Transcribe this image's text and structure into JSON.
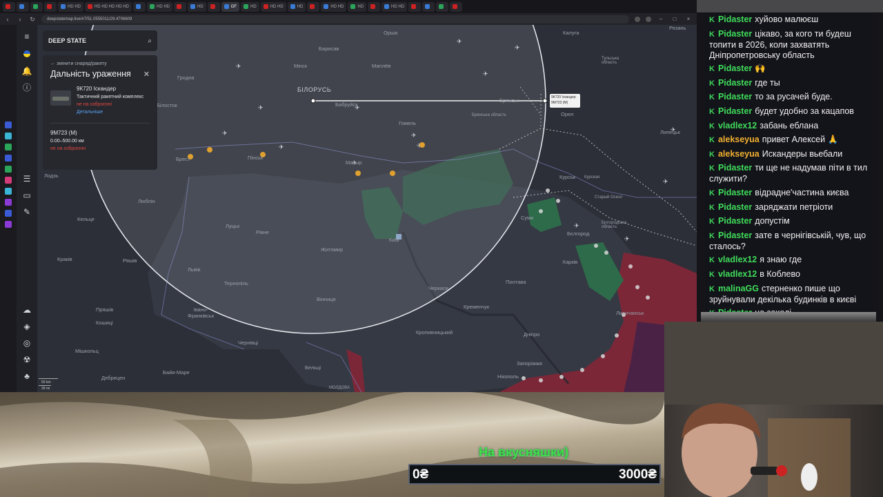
{
  "browser": {
    "tabs": [
      "",
      "",
      "",
      "",
      "HD HD",
      "HD HD HD HD HD",
      "",
      "HD HD",
      "",
      "HD",
      "",
      "GF",
      "HD",
      "HD HD",
      "HD",
      "",
      "HD HD",
      "HD",
      "",
      "HD HD",
      "",
      "",
      "",
      ""
    ],
    "url": "deepstatemap.live/#7/51.0555011/29.4706609"
  },
  "deepstate": {
    "logo": "DEEP STATE",
    "back_link": "змінити снаряд/ракету",
    "title": "Дальність ураження",
    "weapon_name": "9К720 Іскандер",
    "weapon_type": "Тактичний ракетний комплекс",
    "weapon_status": "не на озброєнні",
    "details_link": "Детальніше",
    "missile_name": "9М723 (М)",
    "missile_range": "0.00–500.00 км",
    "missile_status": "не на озброєнні"
  },
  "map": {
    "tooltip_line1": "9К720 Іскандер",
    "tooltip_line2": "9М723 (М)",
    "scale_km": "50 km",
    "scale_mi": "30 mi",
    "cities": [
      {
        "name": "Орша"
      },
      {
        "name": "Калуга"
      },
      {
        "name": "Барисав"
      },
      {
        "name": "Мінск"
      },
      {
        "name": "Магілёв"
      },
      {
        "name": "Гродна"
      },
      {
        "name": "БІЛОРУСЬ"
      },
      {
        "name": "Бабруйск"
      },
      {
        "name": "Брянськ"
      },
      {
        "name": "Орел"
      },
      {
        "name": "Гомель"
      },
      {
        "name": "Пінськ"
      },
      {
        "name": "Мазыр"
      },
      {
        "name": "Брест"
      },
      {
        "name": "Лодзь"
      },
      {
        "name": "Люблін"
      },
      {
        "name": "Луцьк"
      },
      {
        "name": "Рівне"
      },
      {
        "name": "Житомир"
      },
      {
        "name": "Київ"
      },
      {
        "name": "Суми"
      },
      {
        "name": "Курськ"
      },
      {
        "name": "Харків"
      },
      {
        "name": "Полтава"
      },
      {
        "name": "Кременчук"
      },
      {
        "name": "Черкаси"
      },
      {
        "name": "Львів"
      },
      {
        "name": "Тернопіль"
      },
      {
        "name": "Вінниця"
      },
      {
        "name": "Кракiв"
      },
      {
        "name": "Ряшів"
      },
      {
        "name": "Кельце"
      },
      {
        "name": "Пряшів"
      },
      {
        "name": "Кошиці"
      },
      {
        "name": "Мішкольц"
      },
      {
        "name": "Дебрецен"
      },
      {
        "name": "Байя-Маре"
      },
      {
        "name": "Чернівці"
      },
      {
        "name": "Бельці"
      },
      {
        "name": "Кропивницький"
      },
      {
        "name": "Дніпро"
      },
      {
        "name": "Запоріжжя"
      },
      {
        "name": "Нікополь"
      },
      {
        "name": "Лисичанськ"
      },
      {
        "name": "Бєлгород"
      },
      {
        "name": "Липецьк"
      },
      {
        "name": "Рязань"
      },
      {
        "name": "Тульська область"
      },
      {
        "name": "Курская"
      },
      {
        "name": "Брянська область"
      },
      {
        "name": "Білгородська область"
      },
      {
        "name": "Івано-Франківськ"
      },
      {
        "name": "Старый Оскол"
      },
      {
        "name": "МОЛДОВА"
      },
      {
        "name": "Білосток"
      }
    ]
  },
  "chat": [
    {
      "user": "Pidaster",
      "text": "хуйово малюєш",
      "color": "pid"
    },
    {
      "user": "Pidaster",
      "text": "цікаво, за кого ти будеш топити в 2026, коли захватять Дніпропетровську область",
      "color": "pid"
    },
    {
      "user": "Pidaster",
      "text": "🙌",
      "color": "pid"
    },
    {
      "user": "Pidaster",
      "text": "где ты",
      "color": "pid"
    },
    {
      "user": "Pidaster",
      "text": "то за русачей буде.",
      "color": "pid"
    },
    {
      "user": "Pidaster",
      "text": "будет удобно за кацапов",
      "color": "pid"
    },
    {
      "user": "vladlex12",
      "text": "забань еблана",
      "color": "vlad"
    },
    {
      "user": "alekseyua",
      "text": "привет Алексей 🙏",
      "color": "alek"
    },
    {
      "user": "alekseyua",
      "text": "Искандеры вьебали",
      "color": "alek"
    },
    {
      "user": "Pidaster",
      "text": "ти ще не надумав піти в тил служити?",
      "color": "pid"
    },
    {
      "user": "Pidaster",
      "text": "відрадне'частина києва",
      "color": "pid"
    },
    {
      "user": "Pidaster",
      "text": "заряджати петріоти",
      "color": "pid"
    },
    {
      "user": "Pidaster",
      "text": "допустім",
      "color": "pid"
    },
    {
      "user": "Pidaster",
      "text": "зате в чернігівській, чув, що сталось?",
      "color": "pid"
    },
    {
      "user": "vladlex12",
      "text": "я знаю где",
      "color": "vlad"
    },
    {
      "user": "vladlex12",
      "text": "в Коблево",
      "color": "vlad"
    },
    {
      "user": "malinaGG",
      "text": "стерненко пише що зруйнували декілька будинків в києві",
      "color": "mal"
    },
    {
      "user": "Pidaster",
      "text": "на заході",
      "color": "pid"
    }
  ],
  "donation": {
    "title": "На вкусняшки)",
    "current": "0₴",
    "goal": "3000₴",
    "progress": 0.0
  },
  "colors": {
    "map_bg": "#2a2d35",
    "ukraine_control": "#3f4550",
    "occupied": "#8a2a3a",
    "liberated": "#2f6b4a",
    "chat_green": "#3fdc5a",
    "donation_green": "#3ee04a"
  }
}
